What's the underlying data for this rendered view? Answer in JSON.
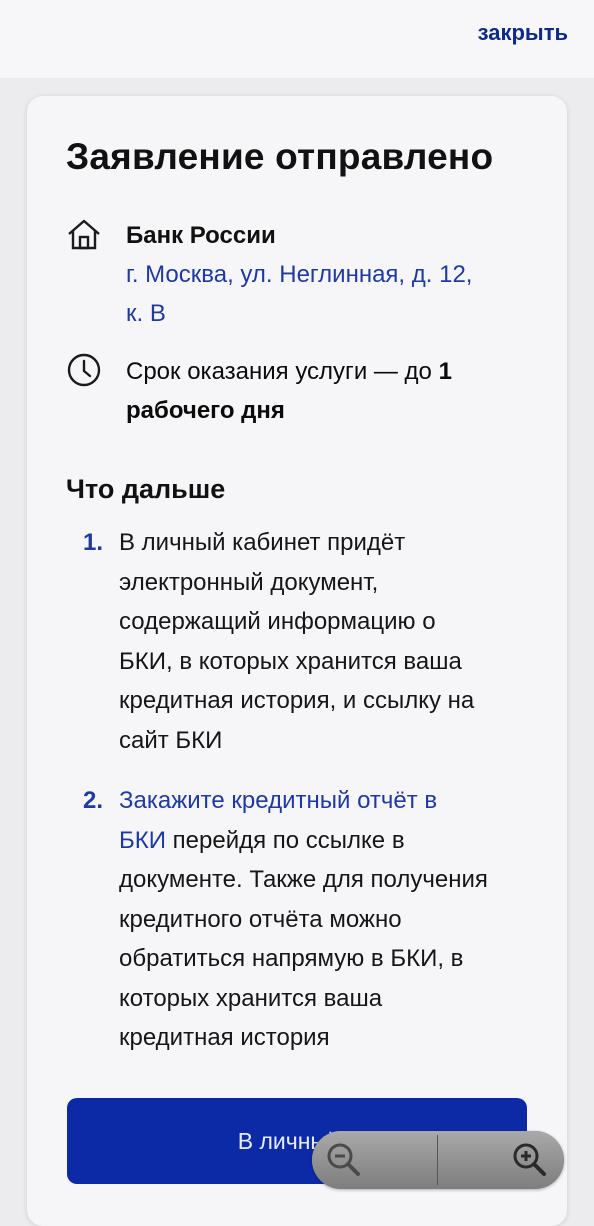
{
  "header": {
    "close_label": "закрыть"
  },
  "card": {
    "title": "Заявление отправлено",
    "bank": {
      "name": "Банк России",
      "address_line1": "г. Москва, ул. Неглинная, д. 12,",
      "address_line2": "к. В",
      "icon": "home-icon"
    },
    "term": {
      "line1_prefix": "Срок оказания услуги — до ",
      "line1_bold": "1",
      "line2_bold": "рабочего дня",
      "icon": "clock-icon"
    },
    "next": {
      "title": "Что дальше",
      "steps": [
        {
          "number": "1.",
          "lines": [
            "В личный кабинет придёт",
            "электронный документ,",
            "содержащий информацию о",
            "БКИ, в которых хранится ваша",
            "кредитная история, и ссылку на",
            "сайт БКИ"
          ]
        },
        {
          "number": "2.",
          "link_line1": "Закажите кредитный отчёт в",
          "link_line2": "БКИ",
          "line2_rest": " перейдя по ссылке в",
          "lines": [
            "документе. Также для получения",
            "кредитного отчёта можно",
            "обратиться напрямую в БКИ, в",
            "которых хранится ваша",
            "кредитная история"
          ]
        }
      ]
    },
    "button_label": "В личный к"
  },
  "zoom": {
    "zoom_out_icon": "zoom-out-icon",
    "zoom_in_icon": "zoom-in-icon"
  },
  "colors": {
    "accent": "#1f3aa0",
    "button": "#0c2aa6",
    "link_dark": "#0d2a85"
  }
}
